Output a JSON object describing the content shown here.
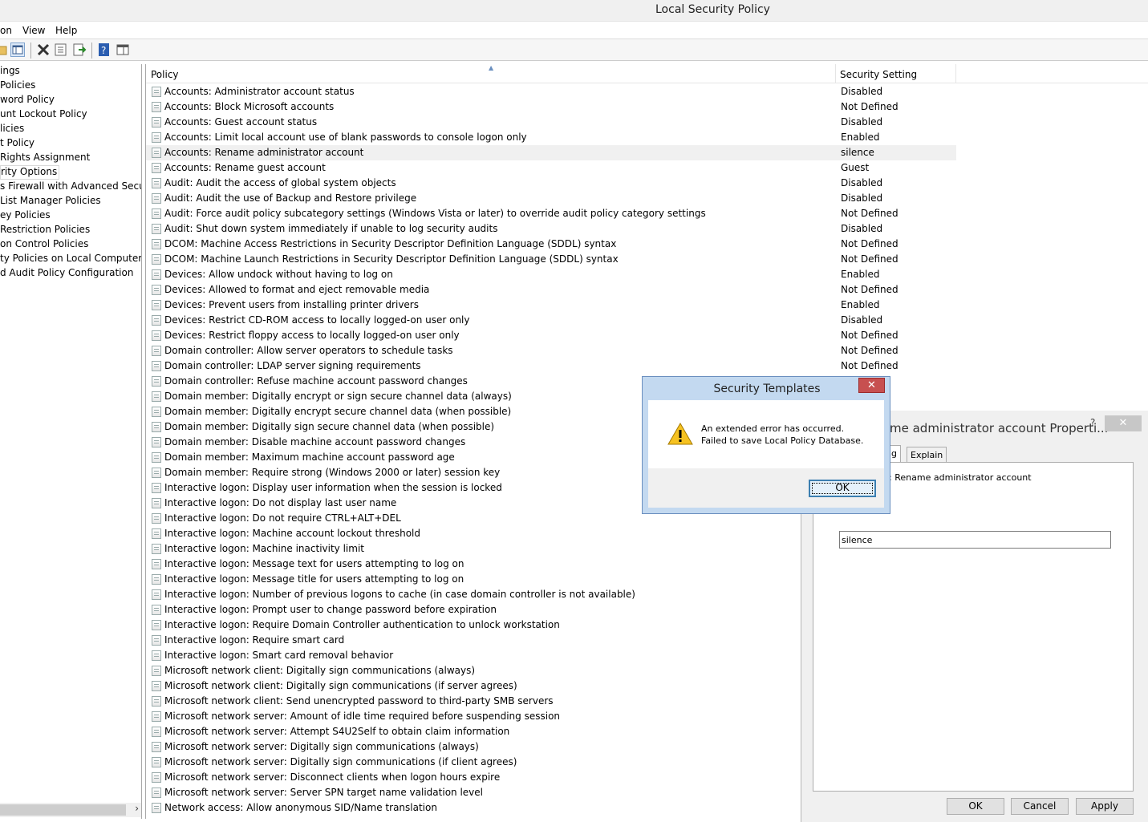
{
  "window": {
    "title": "Local Security Policy"
  },
  "menu": [
    "on",
    "View",
    "Help"
  ],
  "tree": {
    "items": [
      "ings",
      " Policies",
      "word Policy",
      "unt Lockout Policy",
      "licies",
      "t Policy",
      " Rights Assignment",
      "rity Options",
      "s Firewall with Advanced Security",
      " List Manager Policies",
      "ey Policies",
      " Restriction Policies",
      "on Control Policies",
      "ty Policies on Local Computer",
      "d Audit Policy Configuration"
    ],
    "selected_index": 7
  },
  "list": {
    "columns": {
      "policy": "Policy",
      "setting": "Security Setting"
    },
    "selected_index": 4,
    "rows": [
      {
        "name": "Accounts: Administrator account status",
        "setting": "Disabled"
      },
      {
        "name": "Accounts: Block Microsoft accounts",
        "setting": "Not Defined"
      },
      {
        "name": "Accounts: Guest account status",
        "setting": "Disabled"
      },
      {
        "name": "Accounts: Limit local account use of blank passwords to console logon only",
        "setting": "Enabled"
      },
      {
        "name": "Accounts: Rename administrator account",
        "setting": "silence"
      },
      {
        "name": "Accounts: Rename guest account",
        "setting": "Guest"
      },
      {
        "name": "Audit: Audit the access of global system objects",
        "setting": "Disabled"
      },
      {
        "name": "Audit: Audit the use of Backup and Restore privilege",
        "setting": "Disabled"
      },
      {
        "name": "Audit: Force audit policy subcategory settings (Windows Vista or later) to override audit policy category settings",
        "setting": "Not Defined"
      },
      {
        "name": "Audit: Shut down system immediately if unable to log security audits",
        "setting": "Disabled"
      },
      {
        "name": "DCOM: Machine Access Restrictions in Security Descriptor Definition Language (SDDL) syntax",
        "setting": "Not Defined"
      },
      {
        "name": "DCOM: Machine Launch Restrictions in Security Descriptor Definition Language (SDDL) syntax",
        "setting": "Not Defined"
      },
      {
        "name": "Devices: Allow undock without having to log on",
        "setting": "Enabled"
      },
      {
        "name": "Devices: Allowed to format and eject removable media",
        "setting": "Not Defined"
      },
      {
        "name": "Devices: Prevent users from installing printer drivers",
        "setting": "Enabled"
      },
      {
        "name": "Devices: Restrict CD-ROM access to locally logged-on user only",
        "setting": "Disabled"
      },
      {
        "name": "Devices: Restrict floppy access to locally logged-on user only",
        "setting": "Not Defined"
      },
      {
        "name": "Domain controller: Allow server operators to schedule tasks",
        "setting": "Not Defined"
      },
      {
        "name": "Domain controller: LDAP server signing requirements",
        "setting": "Not Defined"
      },
      {
        "name": "Domain controller: Refuse machine account password changes",
        "setting": ""
      },
      {
        "name": "Domain member: Digitally encrypt or sign secure channel data (always)",
        "setting": ""
      },
      {
        "name": "Domain member: Digitally encrypt secure channel data (when possible)",
        "setting": ""
      },
      {
        "name": "Domain member: Digitally sign secure channel data (when possible)",
        "setting": ""
      },
      {
        "name": "Domain member: Disable machine account password changes",
        "setting": ""
      },
      {
        "name": "Domain member: Maximum machine account password age",
        "setting": ""
      },
      {
        "name": "Domain member: Require strong (Windows 2000 or later) session key",
        "setting": ""
      },
      {
        "name": "Interactive logon: Display user information when the session is locked",
        "setting": ""
      },
      {
        "name": "Interactive logon: Do not display last user name",
        "setting": ""
      },
      {
        "name": "Interactive logon: Do not require CTRL+ALT+DEL",
        "setting": ""
      },
      {
        "name": "Interactive logon: Machine account lockout threshold",
        "setting": ""
      },
      {
        "name": "Interactive logon: Machine inactivity limit",
        "setting": ""
      },
      {
        "name": "Interactive logon: Message text for users attempting to log on",
        "setting": ""
      },
      {
        "name": "Interactive logon: Message title for users attempting to log on",
        "setting": ""
      },
      {
        "name": "Interactive logon: Number of previous logons to cache (in case domain controller is not available)",
        "setting": ""
      },
      {
        "name": "Interactive logon: Prompt user to change password before expiration",
        "setting": ""
      },
      {
        "name": "Interactive logon: Require Domain Controller authentication to unlock workstation",
        "setting": ""
      },
      {
        "name": "Interactive logon: Require smart card",
        "setting": ""
      },
      {
        "name": "Interactive logon: Smart card removal behavior",
        "setting": ""
      },
      {
        "name": "Microsoft network client: Digitally sign communications (always)",
        "setting": ""
      },
      {
        "name": "Microsoft network client: Digitally sign communications (if server agrees)",
        "setting": ""
      },
      {
        "name": "Microsoft network client: Send unencrypted password to third-party SMB servers",
        "setting": ""
      },
      {
        "name": "Microsoft network server: Amount of idle time required before suspending session",
        "setting": ""
      },
      {
        "name": "Microsoft network server: Attempt S4U2Self to obtain claim information",
        "setting": ""
      },
      {
        "name": "Microsoft network server: Digitally sign communications (always)",
        "setting": ""
      },
      {
        "name": "Microsoft network server: Digitally sign communications (if client agrees)",
        "setting": ""
      },
      {
        "name": "Microsoft network server: Disconnect clients when logon hours expire",
        "setting": ""
      },
      {
        "name": "Microsoft network server: Server SPN target name validation level",
        "setting": ""
      },
      {
        "name": "Network access: Allow anonymous SID/Name translation",
        "setting": ""
      }
    ]
  },
  "properties_dialog": {
    "title": "me administrator account Properti...",
    "help": "?",
    "close": "✕",
    "tabs": [
      "ng",
      "Explain"
    ],
    "label": "ts: Rename administrator account",
    "value": "silence",
    "buttons": {
      "ok": "OK",
      "cancel": "Cancel",
      "apply": "Apply"
    }
  },
  "message_dialog": {
    "title": "Security Templates",
    "close": "✕",
    "line1": "An extended error has occurred.",
    "line2": "Failed to save Local Policy Database.",
    "ok": "OK",
    "icon": "warning-icon"
  }
}
